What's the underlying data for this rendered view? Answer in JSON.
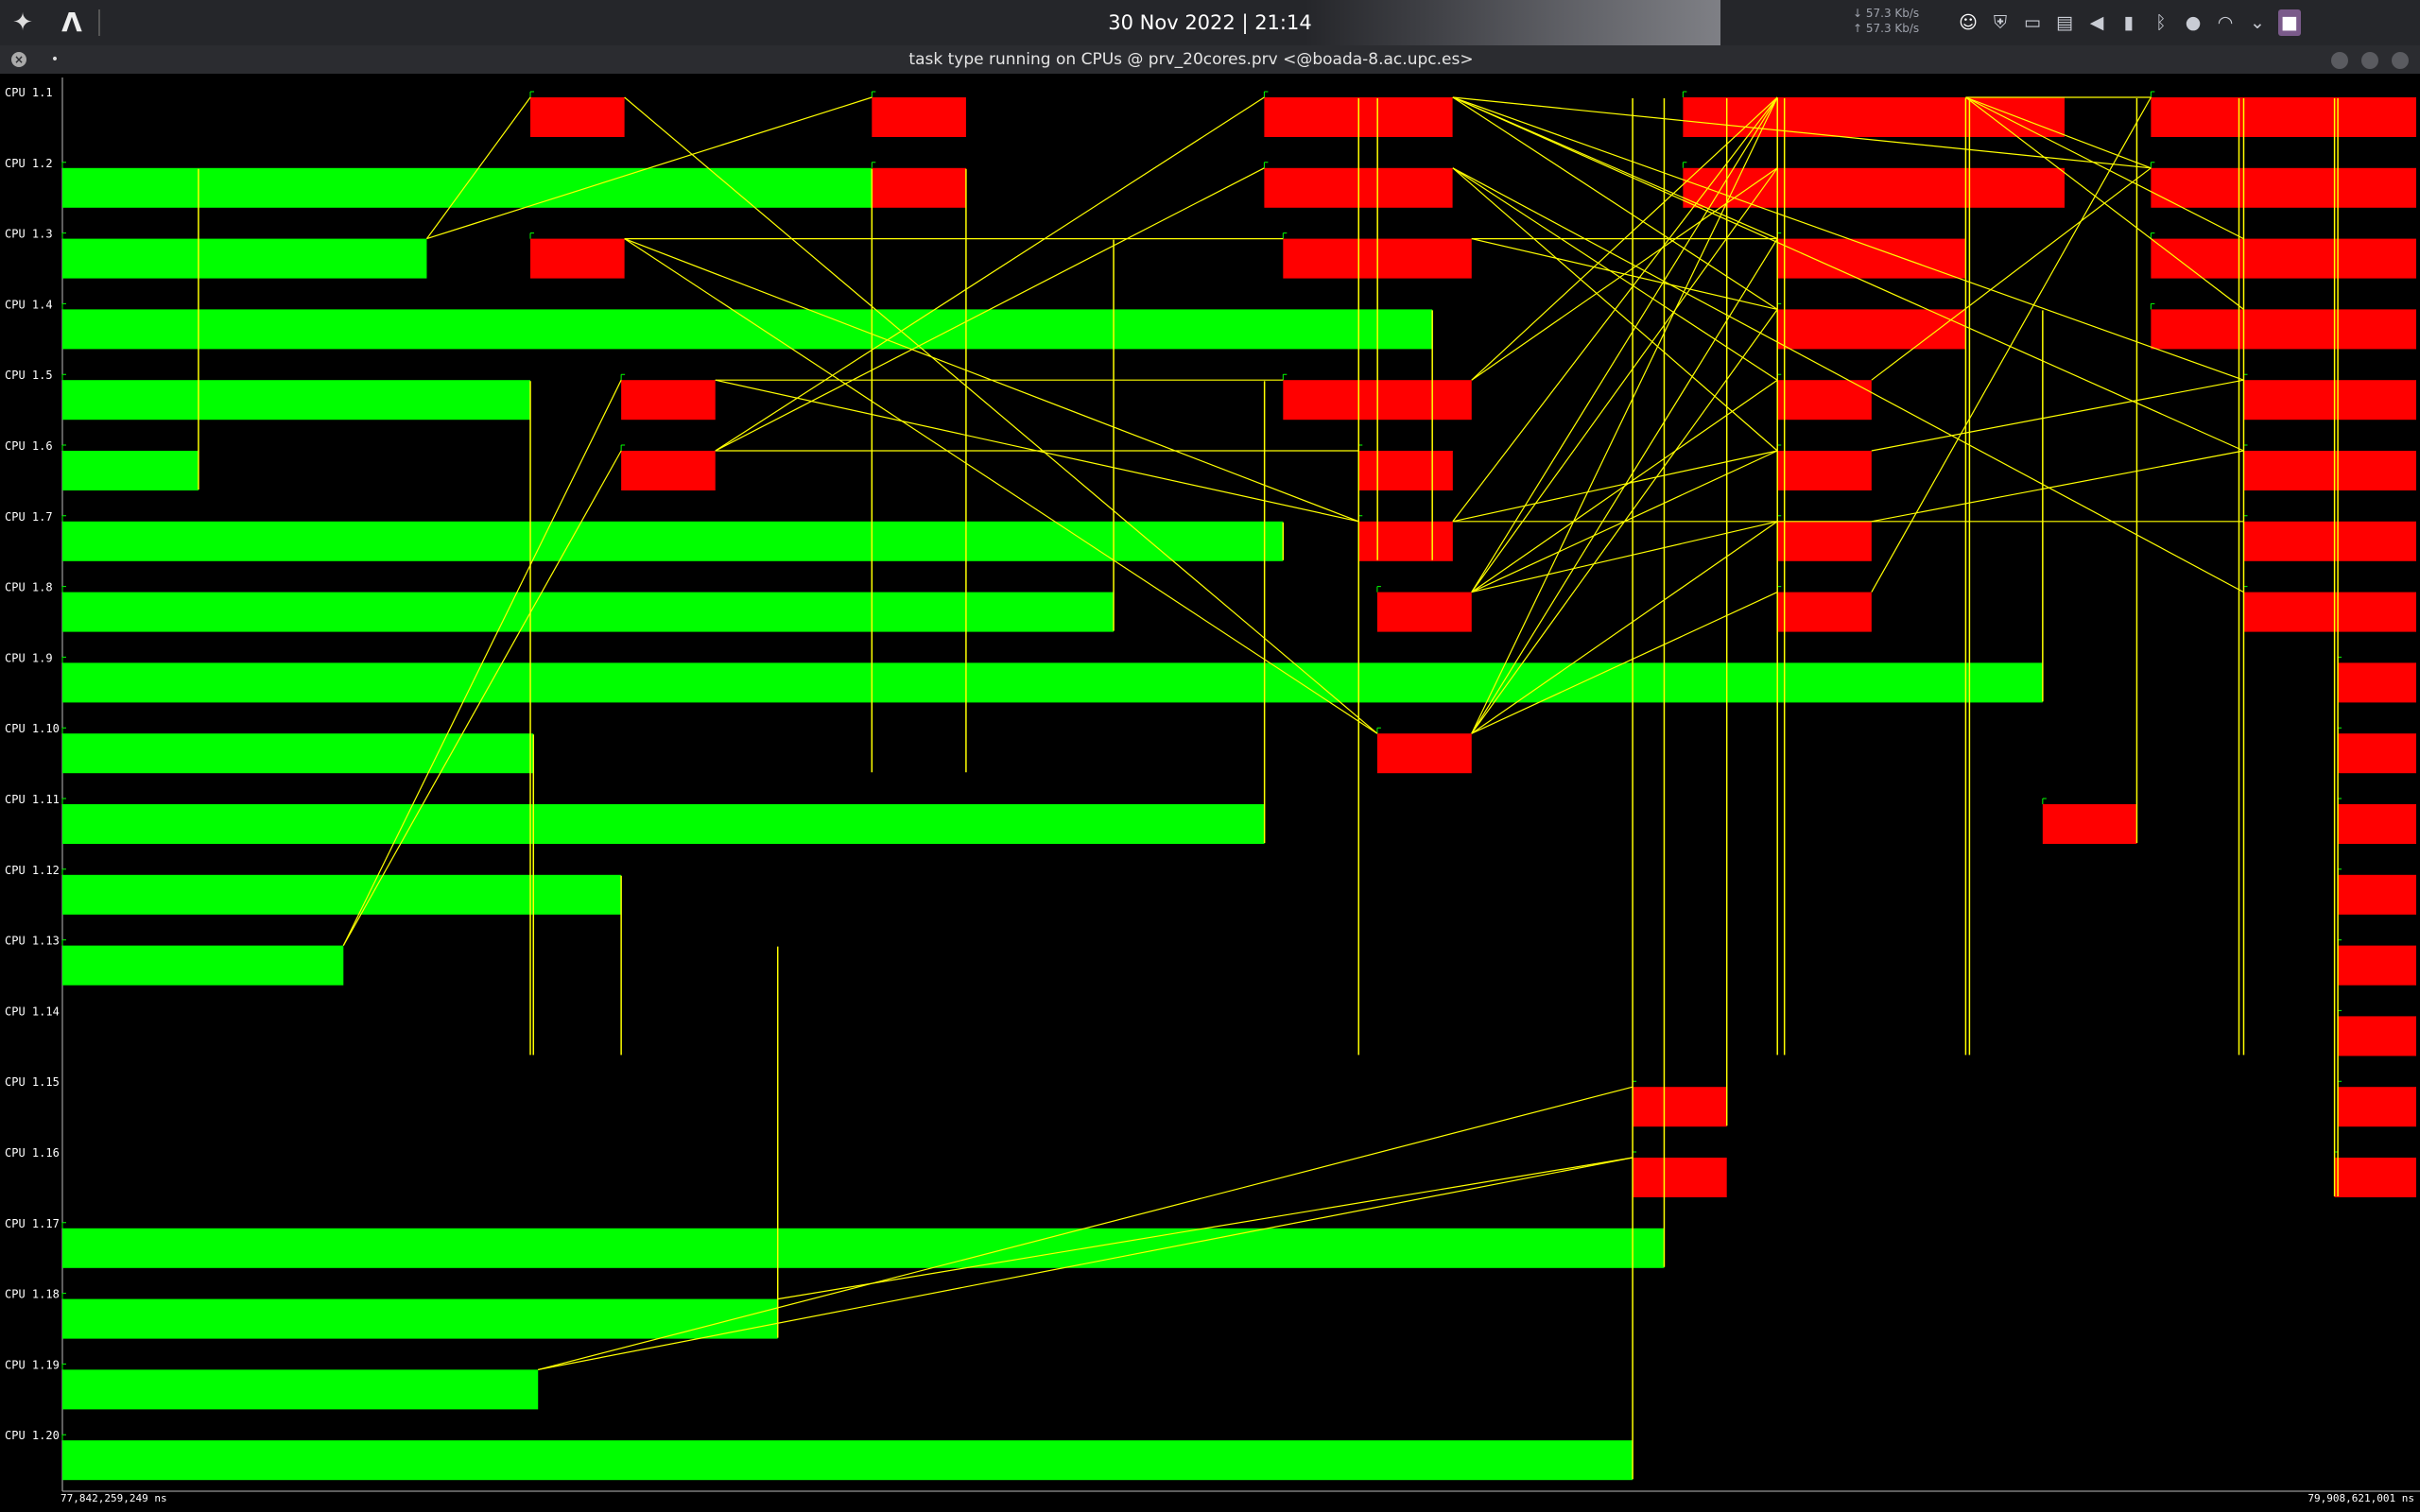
{
  "topbar": {
    "clock": "30 Nov 2022 | 21:14",
    "net_down": "↓ 57.3 Kb/s",
    "net_up": "↑ 57.3 Kb/s",
    "launcher_icon": "app-launcher-icon",
    "app_icon": "arch-logo-icon",
    "tray_icons": [
      "discord-icon",
      "shield-icon",
      "window-icon",
      "clipboard-icon",
      "volume-icon",
      "battery-icon",
      "bluetooth-icon",
      "microphone-icon",
      "wifi-icon",
      "chevron-down-icon",
      "workspace-icon"
    ]
  },
  "window": {
    "title": "task type running on CPUs @ prv_20cores.prv <@boada-8.ac.upc.es>"
  },
  "timeline": {
    "start_time": "77,842,259,249 ns",
    "end_time": "79,908,621,001 ns",
    "colors": {
      "running": "#00ff00",
      "task": "#ff0000",
      "comm": "#ffff00",
      "flag": "#00ff00",
      "axis": "#bbbbbb"
    },
    "rows": [
      {
        "label": "CPU 1.1",
        "bars": [
          {
            "s": 0.1988,
            "e": 0.2388,
            "c": "red"
          },
          {
            "s": 0.3439,
            "e": 0.3839,
            "c": "red"
          },
          {
            "s": 0.5106,
            "e": 0.5906,
            "c": "red"
          },
          {
            "s": 0.6885,
            "e": 0.8506,
            "c": "red"
          },
          {
            "s": 0.8873,
            "e": 1.0,
            "c": "red"
          }
        ]
      },
      {
        "label": "CPU 1.2",
        "bars": [
          {
            "s": 0.0,
            "e": 0.3439,
            "c": "green"
          },
          {
            "s": 0.3439,
            "e": 0.3839,
            "c": "red"
          },
          {
            "s": 0.5106,
            "e": 0.5906,
            "c": "red"
          },
          {
            "s": 0.6885,
            "e": 0.8506,
            "c": "red"
          },
          {
            "s": 0.8873,
            "e": 1.0,
            "c": "red"
          }
        ]
      },
      {
        "label": "CPU 1.3",
        "bars": [
          {
            "s": 0.0,
            "e": 0.1548,
            "c": "green"
          },
          {
            "s": 0.1988,
            "e": 0.2388,
            "c": "red"
          },
          {
            "s": 0.5186,
            "e": 0.5987,
            "c": "red"
          },
          {
            "s": 0.7286,
            "e": 0.8086,
            "c": "red"
          },
          {
            "s": 0.8873,
            "e": 1.0,
            "c": "red"
          }
        ]
      },
      {
        "label": "CPU 1.4",
        "bars": [
          {
            "s": 0.0,
            "e": 0.582,
            "c": "green"
          },
          {
            "s": 0.7286,
            "e": 0.8086,
            "c": "red"
          },
          {
            "s": 0.8873,
            "e": 1.0,
            "c": "red"
          }
        ]
      },
      {
        "label": "CPU 1.5",
        "bars": [
          {
            "s": 0.0,
            "e": 0.1988,
            "c": "green"
          },
          {
            "s": 0.2374,
            "e": 0.2774,
            "c": "red"
          },
          {
            "s": 0.5186,
            "e": 0.5987,
            "c": "red"
          },
          {
            "s": 0.7286,
            "e": 0.7686,
            "c": "red"
          },
          {
            "s": 0.9267,
            "e": 1.0,
            "c": "red"
          }
        ]
      },
      {
        "label": "CPU 1.6",
        "bars": [
          {
            "s": 0.0,
            "e": 0.0578,
            "c": "green"
          },
          {
            "s": 0.2374,
            "e": 0.2774,
            "c": "red"
          },
          {
            "s": 0.5507,
            "e": 0.5907,
            "c": "red"
          },
          {
            "s": 0.7286,
            "e": 0.7686,
            "c": "red"
          },
          {
            "s": 0.9267,
            "e": 1.0,
            "c": "red"
          }
        ]
      },
      {
        "label": "CPU 1.7",
        "bars": [
          {
            "s": 0.0,
            "e": 0.5186,
            "c": "green"
          },
          {
            "s": 0.5507,
            "e": 0.5907,
            "c": "red"
          },
          {
            "s": 0.7286,
            "e": 0.7686,
            "c": "red"
          },
          {
            "s": 0.9267,
            "e": 1.0,
            "c": "red"
          }
        ]
      },
      {
        "label": "CPU 1.8",
        "bars": [
          {
            "s": 0.0,
            "e": 0.4466,
            "c": "green"
          },
          {
            "s": 0.5586,
            "e": 0.5987,
            "c": "red"
          },
          {
            "s": 0.7286,
            "e": 0.7686,
            "c": "red"
          },
          {
            "s": 0.9267,
            "e": 1.0,
            "c": "red"
          }
        ]
      },
      {
        "label": "CPU 1.9",
        "bars": [
          {
            "s": 0.0,
            "e": 0.8413,
            "c": "green"
          },
          {
            "s": 0.9667,
            "e": 1.0,
            "c": "red"
          }
        ]
      },
      {
        "label": "CPU 1.10",
        "bars": [
          {
            "s": 0.0,
            "e": 0.2001,
            "c": "green"
          },
          {
            "s": 0.5586,
            "e": 0.5987,
            "c": "red"
          },
          {
            "s": 0.9667,
            "e": 1.0,
            "c": "red"
          }
        ]
      },
      {
        "label": "CPU 1.11",
        "bars": [
          {
            "s": 0.0,
            "e": 0.5107,
            "c": "green"
          },
          {
            "s": 0.8413,
            "e": 0.8813,
            "c": "red"
          },
          {
            "s": 0.9667,
            "e": 1.0,
            "c": "red"
          }
        ]
      },
      {
        "label": "CPU 1.12",
        "bars": [
          {
            "s": 0.0,
            "e": 0.2374,
            "c": "green"
          },
          {
            "s": 0.9667,
            "e": 1.0,
            "c": "red"
          }
        ]
      },
      {
        "label": "CPU 1.13",
        "bars": [
          {
            "s": 0.0,
            "e": 0.1194,
            "c": "green"
          },
          {
            "s": 0.9667,
            "e": 1.0,
            "c": "red"
          }
        ]
      },
      {
        "label": "CPU 1.14",
        "bars": [
          {
            "s": 0.9667,
            "e": 1.0,
            "c": "red"
          }
        ]
      },
      {
        "label": "CPU 1.15",
        "bars": [
          {
            "s": 0.6671,
            "e": 0.7071,
            "c": "red"
          },
          {
            "s": 0.9667,
            "e": 1.0,
            "c": "red"
          }
        ]
      },
      {
        "label": "CPU 1.16",
        "bars": [
          {
            "s": 0.6671,
            "e": 0.7071,
            "c": "red"
          },
          {
            "s": 0.9653,
            "e": 1.0,
            "c": "red"
          }
        ]
      },
      {
        "label": "CPU 1.17",
        "bars": [
          {
            "s": 0.0,
            "e": 0.6805,
            "c": "green"
          }
        ]
      },
      {
        "label": "CPU 1.18",
        "bars": [
          {
            "s": 0.0,
            "e": 0.3039,
            "c": "green"
          }
        ]
      },
      {
        "label": "CPU 1.19",
        "bars": [
          {
            "s": 0.0,
            "e": 0.2021,
            "c": "green"
          }
        ]
      },
      {
        "label": "CPU 1.20",
        "bars": [
          {
            "s": 0.0,
            "e": 0.6671,
            "c": "green"
          }
        ]
      }
    ],
    "comms": [
      [
        0.1548,
        3,
        0.1988,
        1
      ],
      [
        0.1548,
        3,
        0.3439,
        1
      ],
      [
        0.2388,
        1,
        0.5586,
        10
      ],
      [
        0.2388,
        3,
        0.5507,
        7
      ],
      [
        0.2388,
        3,
        0.5586,
        10
      ],
      [
        0.2388,
        3,
        0.5186,
        3
      ],
      [
        0.2774,
        5,
        0.5186,
        5
      ],
      [
        0.2774,
        5,
        0.5507,
        7
      ],
      [
        0.2774,
        6,
        0.5106,
        1
      ],
      [
        0.2774,
        6,
        0.5106,
        2
      ],
      [
        0.2774,
        6,
        0.5507,
        6
      ],
      [
        0.1194,
        13,
        0.2374,
        5
      ],
      [
        0.1194,
        13,
        0.2374,
        6
      ],
      [
        0.5987,
        3,
        0.7286,
        3
      ],
      [
        0.5987,
        3,
        0.7286,
        4
      ],
      [
        0.5987,
        5,
        0.7286,
        1
      ],
      [
        0.5987,
        5,
        0.7286,
        2
      ],
      [
        0.5907,
        1,
        0.7286,
        4
      ],
      [
        0.5907,
        1,
        0.7286,
        3
      ],
      [
        0.5907,
        1,
        0.9267,
        5
      ],
      [
        0.5907,
        1,
        0.9267,
        6
      ],
      [
        0.5907,
        1,
        0.8873,
        2
      ],
      [
        0.5907,
        2,
        0.7286,
        5
      ],
      [
        0.5907,
        2,
        0.7286,
        6
      ],
      [
        0.5907,
        2,
        0.9267,
        8
      ],
      [
        0.5987,
        8,
        0.7286,
        1
      ],
      [
        0.5987,
        8,
        0.7286,
        2
      ],
      [
        0.5987,
        8,
        0.7286,
        5
      ],
      [
        0.5987,
        8,
        0.7286,
        6
      ],
      [
        0.5987,
        8,
        0.7286,
        7
      ],
      [
        0.5987,
        10,
        0.7286,
        1
      ],
      [
        0.5987,
        10,
        0.7286,
        3
      ],
      [
        0.5987,
        10,
        0.7286,
        4
      ],
      [
        0.5987,
        10,
        0.7286,
        7
      ],
      [
        0.5987,
        10,
        0.7286,
        8
      ],
      [
        0.5907,
        7,
        0.7286,
        1
      ],
      [
        0.5907,
        7,
        0.7286,
        6
      ],
      [
        0.5907,
        7,
        0.9267,
        7
      ],
      [
        0.8086,
        1,
        0.9267,
        3
      ],
      [
        0.8086,
        1,
        0.8873,
        1
      ],
      [
        0.8086,
        1,
        0.8873,
        2
      ],
      [
        0.8086,
        1,
        0.9267,
        4
      ],
      [
        0.7686,
        5,
        0.8873,
        2
      ],
      [
        0.7686,
        6,
        0.9267,
        5
      ],
      [
        0.7686,
        7,
        0.9267,
        6
      ],
      [
        0.7686,
        8,
        0.8873,
        1
      ],
      [
        0.2021,
        19,
        0.6671,
        15
      ],
      [
        0.2021,
        19,
        0.6671,
        16
      ],
      [
        0.3039,
        18,
        0.6671,
        16
      ]
    ],
    "vlines": [
      [
        0.0578,
        2,
        6
      ],
      [
        0.1988,
        5,
        14
      ],
      [
        0.2001,
        10,
        14
      ],
      [
        0.2374,
        12,
        14
      ],
      [
        0.3039,
        13,
        18
      ],
      [
        0.3439,
        2,
        10
      ],
      [
        0.3839,
        2,
        10
      ],
      [
        0.4466,
        3,
        8
      ],
      [
        0.5107,
        5,
        11
      ],
      [
        0.5186,
        7,
        7
      ],
      [
        0.5507,
        1,
        14
      ],
      [
        0.5587,
        1,
        7
      ],
      [
        0.582,
        4,
        7
      ],
      [
        0.6671,
        1,
        20
      ],
      [
        0.6805,
        1,
        17
      ],
      [
        0.7071,
        1,
        15
      ],
      [
        0.7286,
        1,
        14
      ],
      [
        0.7316,
        1,
        14
      ],
      [
        0.8086,
        1,
        14
      ],
      [
        0.8102,
        1,
        14
      ],
      [
        0.8413,
        4,
        9
      ],
      [
        0.8813,
        1,
        11
      ],
      [
        0.9267,
        1,
        14
      ],
      [
        0.9247,
        1,
        14
      ],
      [
        0.9653,
        1,
        16
      ],
      [
        0.9667,
        1,
        16
      ]
    ]
  }
}
